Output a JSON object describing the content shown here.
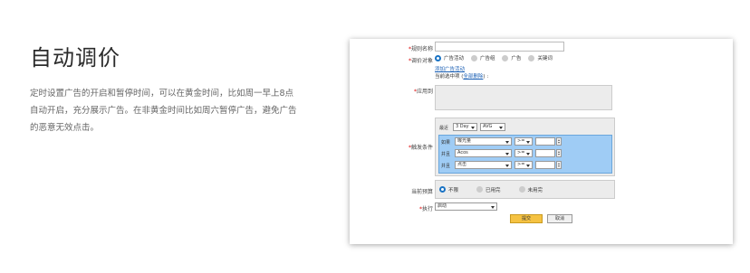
{
  "feature": {
    "title": "自动调价",
    "description": "定时设置广告的开启和暂停时间，可以在黄金时间，比如周一早上8点自动开启，充分展示广告。在非黄金时间比如周六暂停广告，避免广告的恶意无效点击。"
  },
  "form": {
    "required_mark": "*",
    "rule_name": {
      "label": "规则名称",
      "value": ""
    },
    "target": {
      "label": "调价对象",
      "options": [
        {
          "label": "广告活动",
          "selected": true
        },
        {
          "label": "广告组",
          "selected": false
        },
        {
          "label": "广告",
          "selected": false
        },
        {
          "label": "关键词",
          "selected": false
        }
      ]
    },
    "add_link": "添加广告活动",
    "selected_prefix": "当前选中项 (",
    "clear_all_link": "全部删除",
    "selected_suffix": ") :",
    "apply_to": {
      "label": "应用到"
    },
    "trigger": {
      "label": "触发条件",
      "recent_label": "最近",
      "period": "3 Day",
      "aggregate": "AVG",
      "rows": [
        {
          "logic": "如果",
          "metric": "曝光量",
          "op": ">=",
          "value": ""
        },
        {
          "logic": "并且",
          "metric": "Acos",
          "op": ">=",
          "value": ""
        },
        {
          "logic": "并且",
          "metric": "点击",
          "op": ">=",
          "value": ""
        }
      ]
    },
    "budget": {
      "label": "当前预算",
      "options": [
        {
          "label": "不限",
          "selected": true
        },
        {
          "label": "已用完",
          "selected": false
        },
        {
          "label": "未用完",
          "selected": false
        }
      ]
    },
    "execute": {
      "label": "执行",
      "value": "启动"
    },
    "submit_label": "提交",
    "cancel_label": "取消"
  },
  "colors": {
    "accent": "#1a73c4",
    "condition_bg": "#9fccf5",
    "submit_bg": "#f5c242"
  }
}
